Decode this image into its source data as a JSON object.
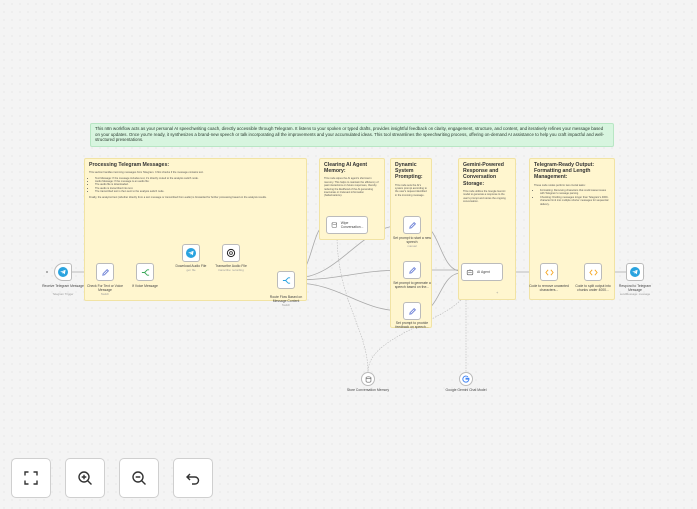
{
  "intro": "This n8n workflow acts as your personal AI speechwriting coach, directly accessible through Telegram. It listens to your spoken or typed drafts, provides insightful feedback on clarity, engagement, structure, and content, and iteratively refines your message based on your updates. Once you're ready, it synthesizes a brand-new speech or talk incorporating all the improvements and your accumulated ideas. This tool streamlines the speechwriting process, offering on-demand AI assistance to help you craft impactful and well-structured presentations.",
  "notes": {
    "telegram": {
      "title": "Processing Telegram Messages:",
      "intro": "This section handles incoming messages from Telegram. It first checks if the message contains text.",
      "items": [
        "Text Message: If the message includes text, it's directly routed to the analysis switch node.",
        "Audio Message: If the message is an audio file:",
        "The audio file is downloaded.",
        "The audio is transcribed into text.",
        "The transcribed text is then sent to the analysis switch node."
      ],
      "outro": "Finally, the analyzed text (whether directly from a text message or transcribed from audio) is forwarded for further processing based on the analysis results."
    },
    "memory": {
      "title": "Clearing AI Agent Memory:",
      "body": "This node wipes the AI agent's short-term memory. This helps to maintain the efficiency of past interactions on future responses, thereby reducing the likelihood of the AI generating inaccurate or irrelevant information (hallucinations)."
    },
    "prompting": {
      "title": "Dynamic System Prompting:",
      "body": "This node sets the AI's system prompt according to the user's request identified in the incoming message."
    },
    "gemini": {
      "title": "Gemini-Powered Response and Conversation Storage:",
      "body": "This node utilizes the Google Gemini model to generate a response to the user's prompt and stores the ongoing conversation."
    },
    "output": {
      "title": "Telegram-Ready Output: Formatting and Length Management:",
      "intro": "These code nodes perform two crucial tasks:",
      "items": [
        "Formatting: Removing characters that could cause issues with Telegram's message parsing.",
        "Chunking: Dividing messages longer than Telegram's 4000-character limit into multiple shorter messages for sequential delivery."
      ]
    }
  },
  "nodes": {
    "receive": {
      "label": "Receive Telegram Message",
      "sub": "Telegram Trigger"
    },
    "check": {
      "label": "Check For Text or Voice Message",
      "sub": "Switch"
    },
    "extract": {
      "label": "If Voice Message",
      "sub": ""
    },
    "download": {
      "label": "Download Audio File",
      "sub": "get: file"
    },
    "transcribe": {
      "label": "Transcribe Audio File",
      "sub": "transcribe: recording"
    },
    "route": {
      "label": "Route Flow Based on Message Content",
      "sub": "Switch"
    },
    "wipe": {
      "label": "Wipe Conversation..."
    },
    "set1": {
      "label": "Set prompt to start a new speech",
      "sub": "manual"
    },
    "set2": {
      "label": "Set prompt to generate a speech based on the...",
      "sub": ""
    },
    "set3": {
      "label": "Set prompt to provide feedback on speech...",
      "sub": ""
    },
    "agent": {
      "label": "AI Agent"
    },
    "code1": {
      "label": "Code to remove unwanted characters..."
    },
    "code2": {
      "label": "Code to split output into chunks under 4000..."
    },
    "respond": {
      "label": "Respond to Telegram Message",
      "sub": "sendMessage: message"
    },
    "memorynode": {
      "label": "Store Conversation Memory"
    },
    "gemini": {
      "label": "Google Gemini Chat Model"
    }
  },
  "controls": {
    "fit": "fit-view-icon",
    "zoom_in": "zoom-in-icon",
    "zoom_out": "zoom-out-icon",
    "reset": "undo-icon"
  },
  "colors": {
    "telegram": "#2aa3df",
    "accent": "#6a7fd6",
    "note": "#fff6cf",
    "intro": "#d7f5df",
    "code": "#f5a623"
  }
}
